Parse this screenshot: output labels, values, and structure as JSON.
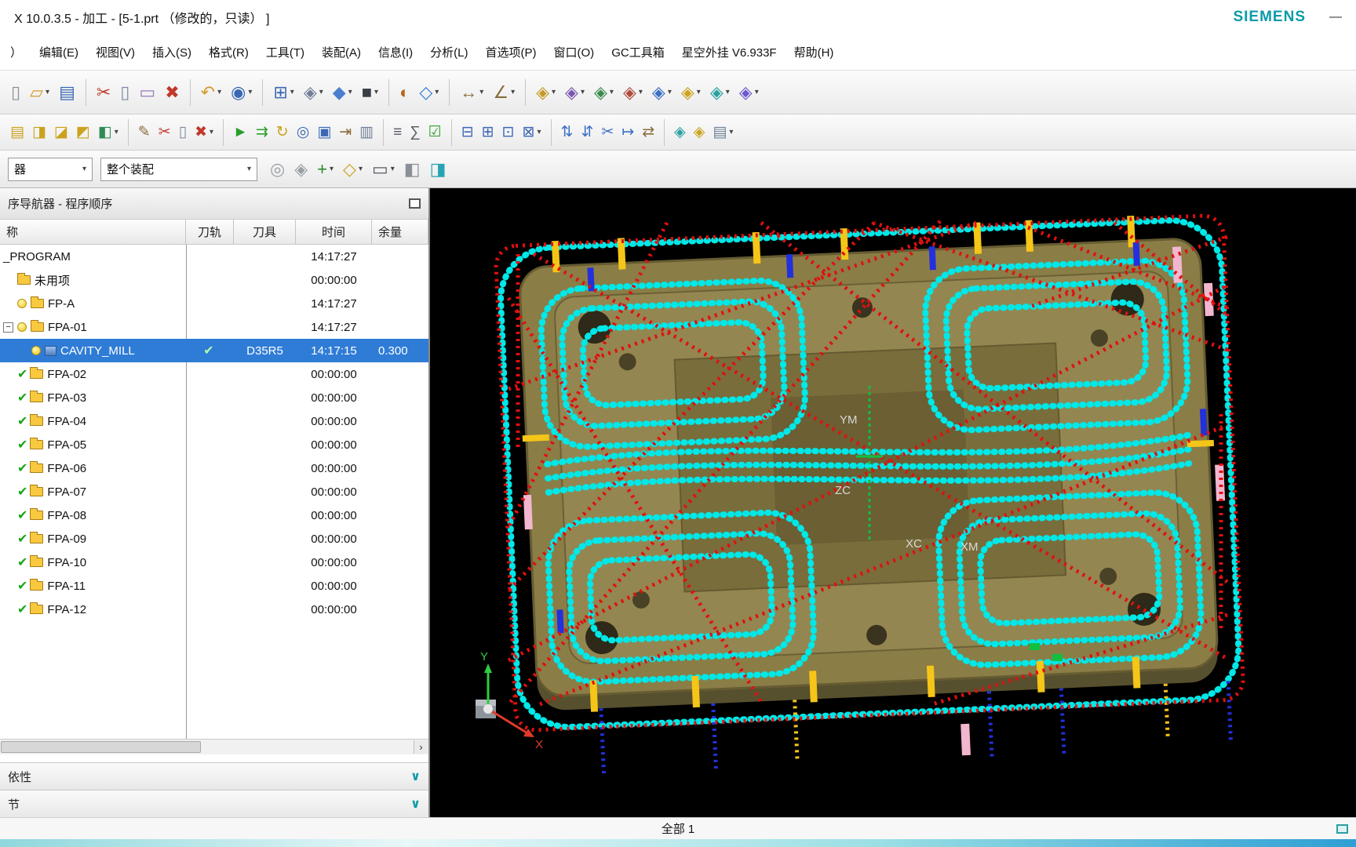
{
  "window": {
    "title": "X 10.0.3.5 - 加工 - [5-1.prt （修改的，只读） ]",
    "brand": "SIEMENS",
    "minimize": "—"
  },
  "menubar": {
    "items": [
      {
        "label": "）"
      },
      {
        "label": "编辑(E)"
      },
      {
        "label": "视图(V)"
      },
      {
        "label": "插入(S)"
      },
      {
        "label": "格式(R)"
      },
      {
        "label": "工具(T)"
      },
      {
        "label": "装配(A)"
      },
      {
        "label": "信息(I)"
      },
      {
        "label": "分析(L)"
      },
      {
        "label": "首选项(P)"
      },
      {
        "label": "窗口(O)"
      },
      {
        "label": "GC工具箱"
      },
      {
        "label": "星空外挂 V6.933F"
      },
      {
        "label": "帮助(H)"
      }
    ]
  },
  "toolbars": {
    "main": [
      {
        "name": "new",
        "glyph": "▯",
        "color": "#8a8f98"
      },
      {
        "name": "open",
        "glyph": "▱",
        "color": "#d79b2a",
        "dd": true
      },
      {
        "name": "save",
        "glyph": "▤",
        "color": "#3b68b5"
      },
      {
        "sep": true
      },
      {
        "name": "cut",
        "glyph": "✂",
        "color": "#c03a2b"
      },
      {
        "name": "copy",
        "glyph": "▯",
        "color": "#7d8aa0"
      },
      {
        "name": "paste",
        "glyph": "▭",
        "color": "#9a7bb5"
      },
      {
        "name": "delete",
        "glyph": "✖",
        "color": "#c0392b"
      },
      {
        "sep": true
      },
      {
        "name": "undo",
        "glyph": "↶",
        "color": "#d79b2a",
        "dd": true
      },
      {
        "name": "view-orient",
        "glyph": "◉",
        "color": "#3b68b5",
        "dd": true
      },
      {
        "sep": true
      },
      {
        "name": "fit-view",
        "glyph": "⊞",
        "color": "#3b68b5",
        "dd": true
      },
      {
        "name": "zoom-window",
        "glyph": "◈",
        "color": "#6f7f95",
        "dd": true
      },
      {
        "name": "shaded-view",
        "glyph": "◆",
        "color": "#4a7fd0",
        "dd": true
      },
      {
        "name": "face-style",
        "glyph": "■",
        "color": "#3a3f46",
        "dd": true
      },
      {
        "sep": true
      },
      {
        "name": "roles",
        "glyph": "◐",
        "color": "#b5651d"
      },
      {
        "name": "snap-point",
        "glyph": "◇",
        "color": "#2e7cd6",
        "dd": true
      },
      {
        "sep": true
      },
      {
        "name": "measure-distance",
        "glyph": "↔",
        "color": "#8a6d3b",
        "dd": true
      },
      {
        "name": "measure-angle",
        "glyph": "∠",
        "color": "#8a6d3b",
        "dd": true
      },
      {
        "sep": true
      },
      {
        "name": "assembly-constraints",
        "glyph": "◈",
        "color": "#c49a2a",
        "dd": true
      },
      {
        "name": "move-component",
        "glyph": "◈",
        "color": "#7a55b0",
        "dd": true
      },
      {
        "name": "add-component",
        "glyph": "◈",
        "color": "#3a8a4a",
        "dd": true
      },
      {
        "name": "pattern-component",
        "glyph": "◈",
        "color": "#b04a3a",
        "dd": true
      },
      {
        "name": "mirror-assembly",
        "glyph": "◈",
        "color": "#3a6fc4",
        "dd": true
      },
      {
        "name": "exploded-views",
        "glyph": "◈",
        "color": "#caa21d",
        "dd": true
      },
      {
        "name": "assembly-sequence",
        "glyph": "◈",
        "color": "#2aa0a0",
        "dd": true
      },
      {
        "name": "wave-geometry-linker",
        "glyph": "◈",
        "color": "#6a5acd",
        "dd": true
      }
    ],
    "cam": [
      {
        "name": "create-program",
        "glyph": "▤",
        "color": "#caa21d"
      },
      {
        "name": "create-tool",
        "glyph": "◨",
        "color": "#caa21d"
      },
      {
        "name": "create-geometry",
        "glyph": "◪",
        "color": "#caa21d"
      },
      {
        "name": "create-method",
        "glyph": "◩",
        "color": "#caa21d"
      },
      {
        "name": "create-operation",
        "glyph": "◧",
        "color": "#2e8b57",
        "dd": true
      },
      {
        "sep": true
      },
      {
        "name": "edit-object",
        "glyph": "✎",
        "color": "#8a6d3b"
      },
      {
        "name": "cut-object",
        "glyph": "✂",
        "color": "#c03a2b"
      },
      {
        "name": "copy-object",
        "glyph": "▯",
        "color": "#7d8aa0"
      },
      {
        "name": "delete-object",
        "glyph": "✖",
        "color": "#c0392b",
        "dd": true
      },
      {
        "sep": true
      },
      {
        "name": "generate-toolpath",
        "glyph": "►",
        "color": "#2aa02a"
      },
      {
        "name": "parallel-generate",
        "glyph": "⇉",
        "color": "#2aa02a"
      },
      {
        "name": "replay-toolpath",
        "glyph": "↻",
        "color": "#caa21d"
      },
      {
        "name": "verify-toolpath",
        "glyph": "◎",
        "color": "#3b68b5"
      },
      {
        "name": "simulate-machine",
        "glyph": "▣",
        "color": "#3b68b5"
      },
      {
        "name": "post-process",
        "glyph": "⇥",
        "color": "#8a6d3b"
      },
      {
        "name": "shop-documentation",
        "glyph": "▥",
        "color": "#6f7f95"
      },
      {
        "sep": true
      },
      {
        "name": "list-toolpath",
        "glyph": "≡",
        "color": "#555b63"
      },
      {
        "name": "machining-report",
        "glyph": "∑",
        "color": "#555b63"
      },
      {
        "name": "gouge-check",
        "glyph": "☑",
        "color": "#2aa02a"
      },
      {
        "sep": true
      },
      {
        "name": "program-order-view",
        "glyph": "⊟",
        "color": "#3b68b5"
      },
      {
        "name": "machine-tool-view",
        "glyph": "⊞",
        "color": "#3b68b5"
      },
      {
        "name": "geometry-view",
        "glyph": "⊡",
        "color": "#3b68b5"
      },
      {
        "name": "machining-method-view",
        "glyph": "⊠",
        "color": "#3b68b5",
        "dd": true
      },
      {
        "sep": true
      },
      {
        "name": "transform-toolpath",
        "glyph": "⇅",
        "color": "#3a6fc4"
      },
      {
        "name": "divide-toolpath",
        "glyph": "⇵",
        "color": "#3a6fc4"
      },
      {
        "name": "trim-toolpath",
        "glyph": "✂",
        "color": "#3a6fc4"
      },
      {
        "name": "extend-toolpath",
        "glyph": "↦",
        "color": "#3a6fc4"
      },
      {
        "name": "synchronize",
        "glyph": "⇄",
        "color": "#8a6d3b"
      },
      {
        "sep": true
      },
      {
        "name": "tool-display",
        "glyph": "◈",
        "color": "#2aa0a0"
      },
      {
        "name": "workpiece-display",
        "glyph": "◈",
        "color": "#caa21d"
      },
      {
        "name": "operation-navigator",
        "glyph": "▤",
        "color": "#6f7f95",
        "dd": true
      }
    ],
    "selection": [
      {
        "name": "find-component",
        "glyph": "◎",
        "color": "#9aa0a8"
      },
      {
        "name": "select-within",
        "glyph": "◈",
        "color": "#9aa0a8"
      },
      {
        "name": "add-selection",
        "glyph": "+",
        "color": "#2a8a2a",
        "dd": true
      },
      {
        "name": "snap-selection",
        "glyph": "◇",
        "color": "#caa21d",
        "dd": true
      },
      {
        "name": "marquee-select",
        "glyph": "▭",
        "color": "#555b63",
        "dd": true
      },
      {
        "name": "shaded-solid",
        "glyph": "◧",
        "color": "#8a8f98"
      },
      {
        "name": "shaded-teal",
        "glyph": "◨",
        "color": "#27a3b4"
      }
    ]
  },
  "selection_bar": {
    "filter_value": "器",
    "scope_value": "整个装配"
  },
  "navigator": {
    "title": "序导航器 - 程序顺序",
    "columns": [
      "称",
      "刀轨",
      "刀具",
      "时间",
      "余量"
    ],
    "rows": [
      {
        "name": "_PROGRAM",
        "indent": 0,
        "icons": [],
        "time": "14:17:27"
      },
      {
        "name": "未用项",
        "indent": 1,
        "icons": [
          "folder"
        ],
        "time": "00:00:00"
      },
      {
        "name": "FP-A",
        "indent": 1,
        "icons": [
          "bulb",
          "folder"
        ],
        "time": "14:17:27"
      },
      {
        "name": "FPA-01",
        "indent": 0,
        "expander": "−",
        "icons": [
          "bulb",
          "folder"
        ],
        "time": "14:17:27"
      },
      {
        "name": "CAVITY_MILL",
        "indent": 2,
        "icons": [
          "bulb",
          "op"
        ],
        "selected": true,
        "track_check": true,
        "tool": "D35R5",
        "time": "14:17:15",
        "stock": "0.300"
      },
      {
        "name": "FPA-02",
        "indent": 1,
        "icons": [
          "check",
          "folder"
        ],
        "time": "00:00:00"
      },
      {
        "name": "FPA-03",
        "indent": 1,
        "icons": [
          "check",
          "folder"
        ],
        "time": "00:00:00"
      },
      {
        "name": "FPA-04",
        "indent": 1,
        "icons": [
          "check",
          "folder"
        ],
        "time": "00:00:00"
      },
      {
        "name": "FPA-05",
        "indent": 1,
        "icons": [
          "check",
          "folder"
        ],
        "time": "00:00:00"
      },
      {
        "name": "FPA-06",
        "indent": 1,
        "icons": [
          "check",
          "folder"
        ],
        "time": "00:00:00"
      },
      {
        "name": "FPA-07",
        "indent": 1,
        "icons": [
          "check",
          "folder"
        ],
        "time": "00:00:00"
      },
      {
        "name": "FPA-08",
        "indent": 1,
        "icons": [
          "check",
          "folder"
        ],
        "time": "00:00:00"
      },
      {
        "name": "FPA-09",
        "indent": 1,
        "icons": [
          "check",
          "folder"
        ],
        "time": "00:00:00"
      },
      {
        "name": "FPA-10",
        "indent": 1,
        "icons": [
          "check",
          "folder"
        ],
        "time": "00:00:00"
      },
      {
        "name": "FPA-11",
        "indent": 1,
        "icons": [
          "check",
          "folder"
        ],
        "time": "00:00:00"
      },
      {
        "name": "FPA-12",
        "indent": 1,
        "icons": [
          "check",
          "folder"
        ],
        "time": "00:00:00"
      }
    ],
    "sections": [
      {
        "label": "依性"
      },
      {
        "label": "节"
      }
    ]
  },
  "viewport": {
    "axis_labels": [
      {
        "text": "YM"
      },
      {
        "text": "ZC"
      },
      {
        "text": "XC"
      },
      {
        "text": "XM"
      },
      {
        "text": "Y"
      },
      {
        "text": "X"
      }
    ]
  },
  "statusbar": {
    "label": "全部 1"
  }
}
